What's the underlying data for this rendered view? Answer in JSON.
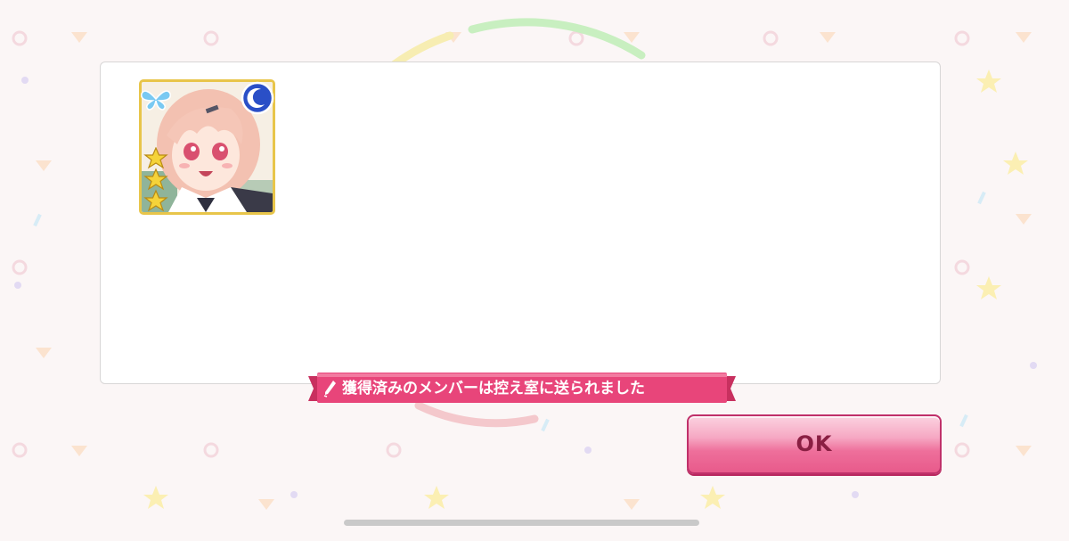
{
  "dialog": {
    "banner_text": "獲得済みのメンバーは控え室に送られました",
    "ok_label": "OK"
  },
  "card": {
    "rarity_stars": 3,
    "attribute_icon": "moon-icon",
    "frame_color": "#e8c54a"
  },
  "colors": {
    "banner": "#e8457a",
    "ok_button": "#ee6f9b",
    "background": "#fbf6f6"
  }
}
